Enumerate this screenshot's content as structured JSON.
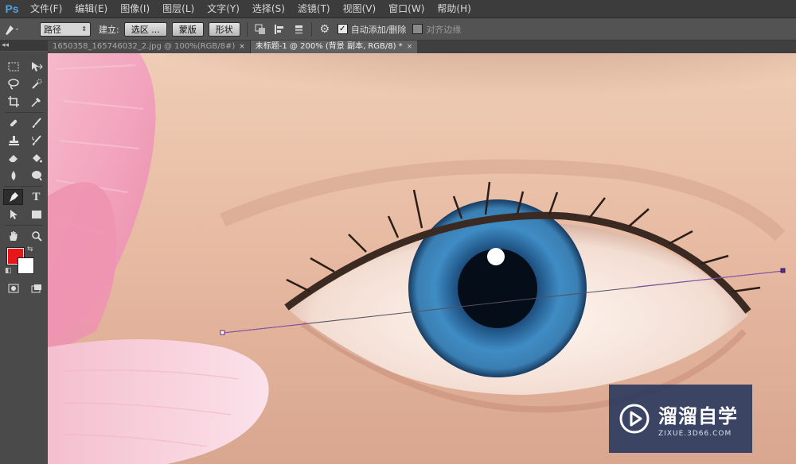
{
  "app": {
    "logo": "Ps"
  },
  "menu": [
    "文件(F)",
    "编辑(E)",
    "图像(I)",
    "图层(L)",
    "文字(Y)",
    "选择(S)",
    "滤镜(T)",
    "视图(V)",
    "窗口(W)",
    "帮助(H)"
  ],
  "options": {
    "mode_select": "路径",
    "make_label": "建立:",
    "selection_button": "选区 ...",
    "mask_button": "蒙版",
    "shape_button": "形状",
    "auto_add_delete": {
      "label": "自动添加/删除",
      "checked": true
    },
    "align_edges": {
      "label": "对齐边缘",
      "checked": false
    }
  },
  "panel_collapse": "◂◂",
  "tabs": [
    {
      "title": "1650358_165746032_2.jpg @ 100%(RGB/8#)",
      "close": "×",
      "active": false
    },
    {
      "title": "未标题-1 @ 200% (背景 副本, RGB/8) *",
      "close": "×",
      "active": true
    }
  ],
  "tools": [
    [
      "marquee-icon",
      "move-icon"
    ],
    [
      "lasso-icon",
      "quick-select-icon"
    ],
    [
      "crop-icon",
      "eyedropper-icon"
    ],
    [
      "healing-brush-icon",
      "brush-icon"
    ],
    [
      "clone-stamp-icon",
      "history-brush-icon"
    ],
    [
      "eraser-icon",
      "paint-bucket-icon"
    ],
    [
      "blur-icon",
      "dodge-icon"
    ],
    [
      "pen-icon",
      "type-icon"
    ],
    [
      "path-select-icon",
      "rectangle-icon"
    ],
    [
      "hand-icon",
      "zoom-icon"
    ]
  ],
  "colors": {
    "foreground": "#e8161b",
    "background": "#ffffff"
  },
  "watermark": {
    "title": "溜溜自学",
    "subtitle": "ZIXUE.3D66.COM"
  }
}
